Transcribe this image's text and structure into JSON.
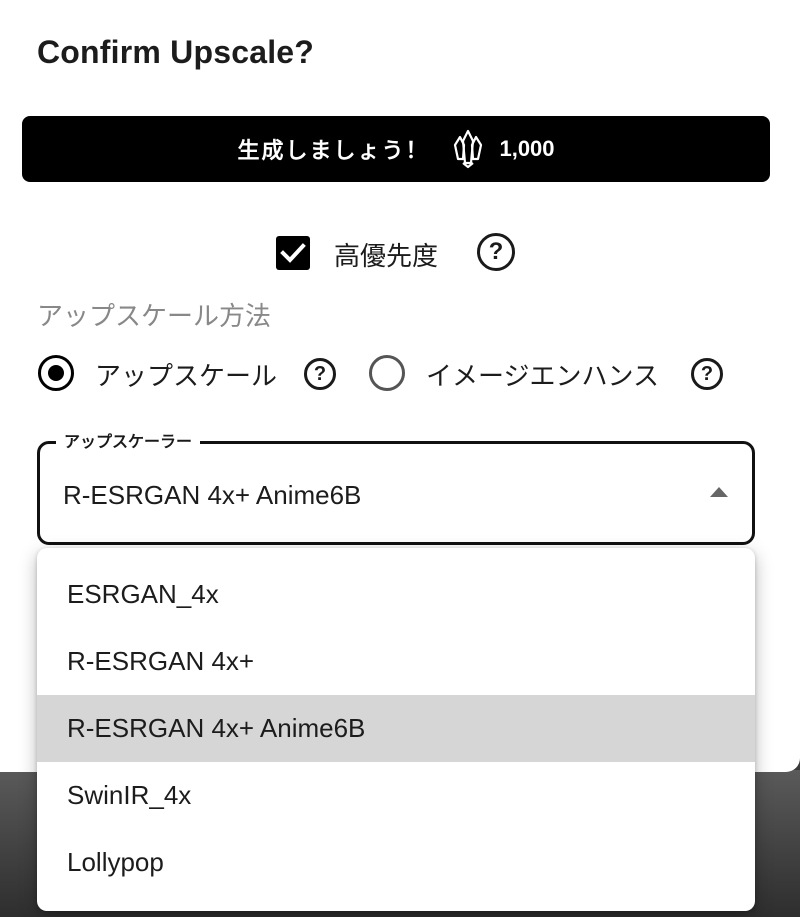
{
  "dialog": {
    "title": "Confirm Upscale?",
    "generate_button": {
      "label": "生成しましょう！",
      "cost": "1,000"
    },
    "priority": {
      "label": "高優先度",
      "checked": true
    },
    "method": {
      "label": "アップスケール方法",
      "options": [
        {
          "label": "アップスケール",
          "checked": true
        },
        {
          "label": "イメージエンハンス",
          "checked": false
        }
      ]
    },
    "upscaler": {
      "legend": "アップスケーラー",
      "value": "R-ESRGAN 4x+ Anime6B",
      "options": [
        {
          "label": "ESRGAN_4x",
          "selected": false
        },
        {
          "label": "R-ESRGAN 4x+",
          "selected": false
        },
        {
          "label": "R-ESRGAN 4x+ Anime6B",
          "selected": true
        },
        {
          "label": "SwinIR_4x",
          "selected": false
        },
        {
          "label": "Lollypop",
          "selected": false
        }
      ]
    }
  },
  "icons": {
    "crystal": "crystal-icon",
    "help": "help-circle-icon",
    "help_glyph": "?",
    "check": "checkmark-icon",
    "caret": "caret-up-icon"
  }
}
